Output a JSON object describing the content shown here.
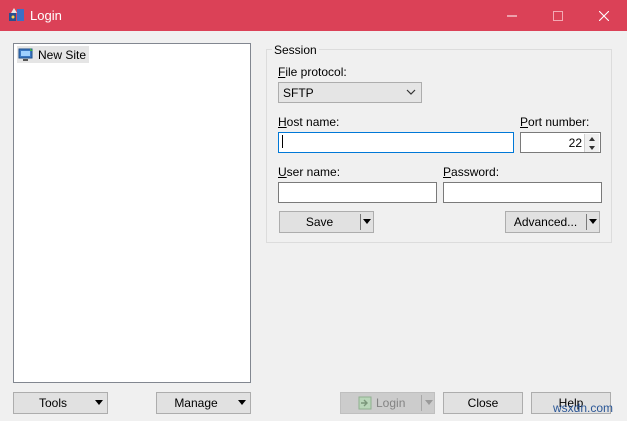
{
  "window": {
    "title": "Login"
  },
  "site_tree": {
    "items": [
      {
        "label": "New Site",
        "icon": "computer-icon",
        "selected": true
      }
    ]
  },
  "session": {
    "group_title": "Session",
    "file_protocol": {
      "label_first": "F",
      "label_rest": "ile protocol:",
      "value": "SFTP"
    },
    "host_name": {
      "label_first": "H",
      "label_rest": "ost name:",
      "value": ""
    },
    "port_number": {
      "label_first": "P",
      "label_rest": "ort number:",
      "value": "22"
    },
    "user_name": {
      "label_first": "U",
      "label_rest": "ser name:",
      "value": ""
    },
    "password": {
      "label_first": "P",
      "label_rest": "assword:",
      "value": ""
    },
    "save_label": "Save",
    "advanced_label": "Advanced..."
  },
  "footer": {
    "tools_label": "Tools",
    "manage_label": "Manage",
    "login_label": "Login",
    "close_label": "Close",
    "help_label": "Help"
  },
  "watermark": "wsxdn.com",
  "colors": {
    "titlebar": "#db4157",
    "focus_border": "#0078d7"
  }
}
